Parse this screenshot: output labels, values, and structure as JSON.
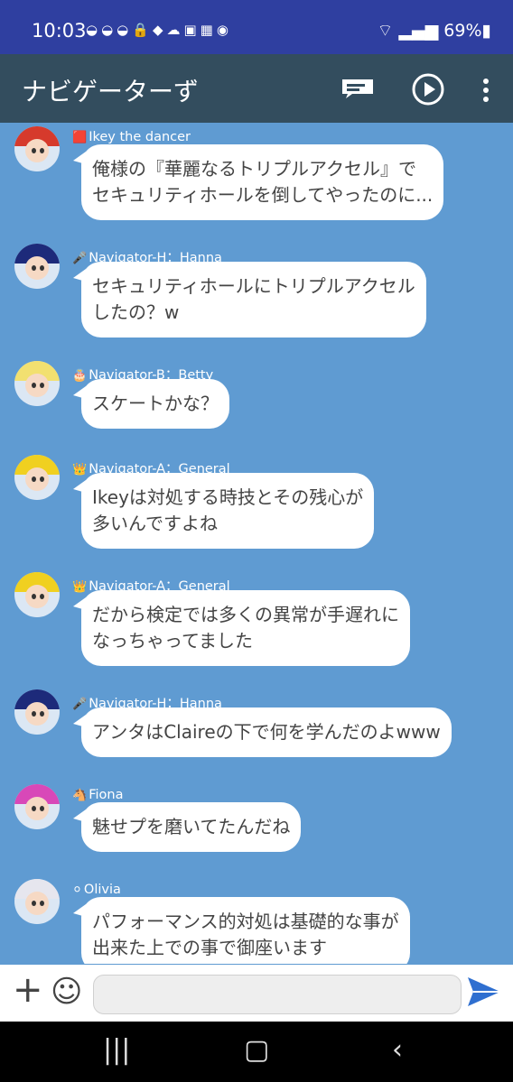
{
  "status": {
    "time": "10:03",
    "battery": "69%"
  },
  "appbar": {
    "title": "ナビゲーターず"
  },
  "messages": [
    {
      "name": "Ikey the dancer",
      "badge": "🟥",
      "lines": [
        "俺様の『華麗なるトリプルアクセル』で",
        "セキュリティホールを倒してやったのに..."
      ]
    },
    {
      "name": "Navigator-H：Hanna",
      "badge": "🎤",
      "lines": [
        "セキュリティホールにトリプルアクセル",
        "したの？w"
      ]
    },
    {
      "name": "Navigator-B：Betty",
      "badge": "🎂",
      "lines": [
        "スケートかな？"
      ]
    },
    {
      "name": "Navigator-A：General",
      "badge": "👑",
      "lines": [
        "Ikeyは対処する時技とその残心が",
        "多いんですよね"
      ]
    },
    {
      "name": "Navigator-A：General",
      "badge": "👑",
      "lines": [
        "だから検定では多くの異常が手遅れに",
        "なっちゃってました"
      ]
    },
    {
      "name": "Navigator-H：Hanna",
      "badge": "🎤",
      "lines": [
        "アンタはClaireの下で何を学んだのよwww"
      ]
    },
    {
      "name": "Fiona",
      "badge": "🐴",
      "lines": [
        "魅せプを磨いてたんだね"
      ]
    },
    {
      "name": "Olivia",
      "badge": "⚪",
      "lines": [
        "パフォーマンス的対処は基礎的な事が",
        "出来た上での事で御座います"
      ]
    }
  ],
  "input": {
    "placeholder": ""
  },
  "icons": [
    "message-icon",
    "play-icon",
    "more-icon",
    "add-icon",
    "emoji-icon",
    "send-icon"
  ]
}
